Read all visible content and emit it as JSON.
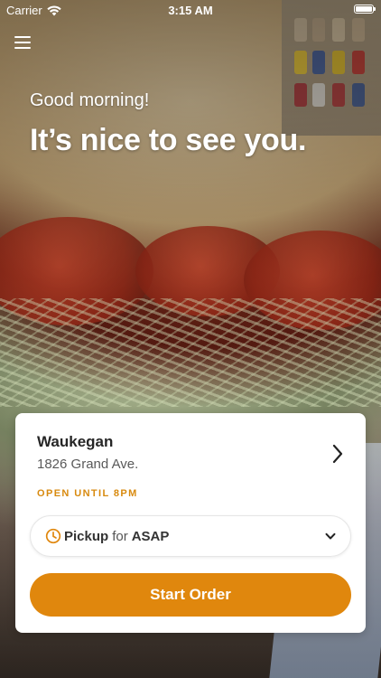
{
  "status_bar": {
    "carrier": "Carrier",
    "time": "3:15 AM",
    "wifi_icon": "wifi-icon",
    "battery_icon": "battery-icon",
    "battery_level": 1.0
  },
  "header": {
    "menu_icon": "hamburger-menu-icon",
    "greeting": "Good morning!",
    "headline": "It’s nice to see you."
  },
  "location_card": {
    "store_name": "Waukegan",
    "address": "1826 Grand Ave.",
    "hours_label": "OPEN UNTIL 8PM",
    "chevron_icon": "chevron-right-icon",
    "pickup": {
      "mode": "Pickup",
      "connector": "for",
      "time": "ASAP",
      "clock_icon": "clock-icon",
      "dropdown_icon": "chevron-down-icon"
    },
    "start_order_label": "Start Order"
  },
  "colors": {
    "accent": "#e0870d",
    "hours_text": "#d88a0f",
    "card_bg": "#ffffff"
  }
}
